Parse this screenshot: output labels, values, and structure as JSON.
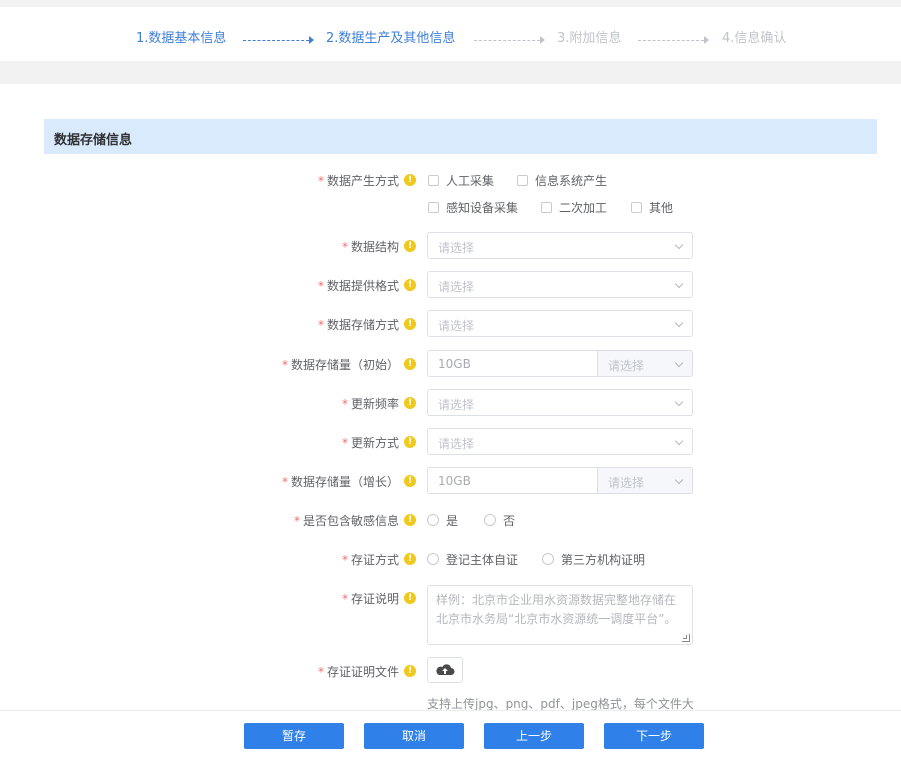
{
  "steps": [
    {
      "label": "1.数据基本信息",
      "state": "done"
    },
    {
      "label": "2.数据生产及其他信息",
      "state": "active"
    },
    {
      "label": "3.附加信息",
      "state": "pending"
    },
    {
      "label": "4.信息确认",
      "state": "pending"
    }
  ],
  "section": {
    "title": "数据存储信息"
  },
  "form": {
    "required_mark": "*",
    "hint_icon": "!",
    "production_method": {
      "label": "数据产生方式",
      "options": [
        "人工采集",
        "信息系统产生",
        "感知设备采集",
        "二次加工",
        "其他"
      ]
    },
    "data_structure": {
      "label": "数据结构",
      "placeholder": "请选择"
    },
    "provide_format": {
      "label": "数据提供格式",
      "placeholder": "请选择"
    },
    "storage_method": {
      "label": "数据存储方式",
      "placeholder": "请选择"
    },
    "storage_initial": {
      "label": "数据存储量（初始）",
      "value": "10GB",
      "unit_placeholder": "请选择"
    },
    "update_frequency": {
      "label": "更新频率",
      "placeholder": "请选择"
    },
    "update_method": {
      "label": "更新方式",
      "placeholder": "请选择"
    },
    "storage_growth": {
      "label": "数据存储量（增长）",
      "value": "10GB",
      "unit_placeholder": "请选择"
    },
    "sensitive": {
      "label": "是否包含敏感信息",
      "options": [
        "是",
        "否"
      ]
    },
    "evidence_method": {
      "label": "存证方式",
      "options": [
        "登记主体自证",
        "第三方机构证明"
      ]
    },
    "evidence_desc": {
      "label": "存证说明",
      "placeholder": "样例：北京市企业用水资源数据完整地存储在北京市水务局“北京市水资源统一调度平台”。"
    },
    "evidence_file": {
      "label": "存证证明文件",
      "upload_icon": "cloud-upload-icon",
      "hint": "支持上传jpg、png、pdf、jpeg格式，每个文件大"
    }
  },
  "footer": {
    "save": "暂存",
    "cancel": "取消",
    "prev": "上一步",
    "next": "下一步"
  },
  "colors": {
    "primary": "#2f80e8",
    "step_active": "#3f7fd6",
    "section_bg": "#d9eafc",
    "hint": "#f0c91d",
    "required": "#f56c6c"
  }
}
